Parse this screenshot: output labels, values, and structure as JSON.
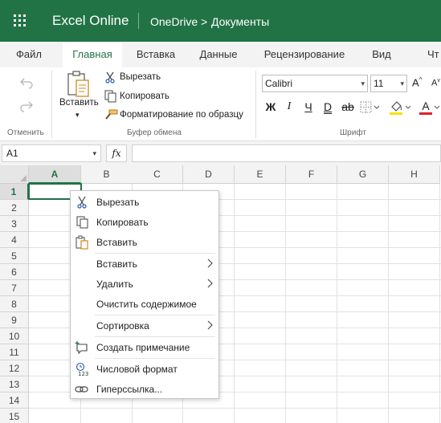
{
  "app": {
    "title": "Excel Online",
    "breadcrumb": [
      "OneDrive",
      "Документы"
    ],
    "breadcrumb_sep": ">"
  },
  "tabs": [
    {
      "label": "Файл",
      "active": false
    },
    {
      "label": "Главная",
      "active": true
    },
    {
      "label": "Вставка",
      "active": false
    },
    {
      "label": "Данные",
      "active": false
    },
    {
      "label": "Рецензирование",
      "active": false
    },
    {
      "label": "Вид",
      "active": false
    },
    {
      "label": "Чт",
      "active": false
    }
  ],
  "ribbon": {
    "undo_group": "Отменить",
    "clipboard": {
      "paste_label": "Вставить",
      "cut_label": "Вырезать",
      "copy_label": "Копировать",
      "format_painter_label": "Форматирование по образцу",
      "group_label": "Буфер обмена"
    },
    "font": {
      "font_name": "Calibri",
      "font_size": "11",
      "bold": "Ж",
      "italic": "I",
      "underline": "Ч",
      "double_underline": "D",
      "strike": "ab",
      "font_color_letter": "A",
      "grow": "A",
      "shrink": "A",
      "group_label": "Шрифт"
    }
  },
  "formula_bar": {
    "name_box": "A1",
    "fx": "fx",
    "formula": ""
  },
  "grid": {
    "columns": [
      "A",
      "B",
      "C",
      "D",
      "E",
      "F",
      "G",
      "H"
    ],
    "rows": [
      "1",
      "2",
      "3",
      "4",
      "5",
      "6",
      "7",
      "8",
      "9",
      "10",
      "11",
      "12",
      "13",
      "14",
      "15"
    ],
    "selected_cell": "A1"
  },
  "context_menu": {
    "items": [
      {
        "label": "Вырезать",
        "icon": "scissors-icon",
        "submenu": false
      },
      {
        "label": "Копировать",
        "icon": "copy-icon",
        "submenu": false
      },
      {
        "label": "Вставить",
        "icon": "paste-icon",
        "submenu": false
      },
      {
        "label": "Вставить",
        "icon": "",
        "submenu": true
      },
      {
        "label": "Удалить",
        "icon": "",
        "submenu": true
      },
      {
        "label": "Очистить содержимое",
        "icon": "",
        "submenu": false
      },
      {
        "label": "Сортировка",
        "icon": "",
        "submenu": true
      },
      {
        "label": "Создать примечание",
        "icon": "comment-icon",
        "submenu": false
      },
      {
        "label": "Числовой формат",
        "icon": "number-format-icon",
        "submenu": false
      },
      {
        "label": "Гиперссылка...",
        "icon": "link-icon",
        "submenu": false
      }
    ]
  },
  "colors": {
    "brand": "#217346",
    "font_color_bar": "#e0202a",
    "highlight_bar": "#f5e400"
  }
}
